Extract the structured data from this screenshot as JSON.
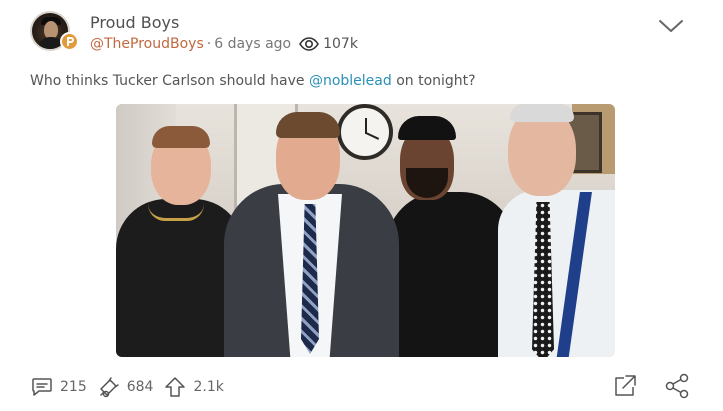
{
  "post": {
    "author": {
      "name": "Proud Boys",
      "handle": "@TheProudBoys",
      "time": "6 days ago",
      "views": "107k",
      "verified_badge": "parler-badge-icon"
    },
    "text": {
      "before": "Who thinks Tucker Carlson should have ",
      "mention": "@noblelead",
      "after": " on tonight?"
    },
    "image_alt": "Photo of four men standing together in an office",
    "actions": {
      "comments": "215",
      "echoes": "684",
      "upvotes": "2.1k"
    }
  },
  "colors": {
    "handle": "#c0683f",
    "mention": "#2b8fb8",
    "badge": "#e29a3a",
    "text": "#555555"
  },
  "icons": [
    "chevron-down-icon",
    "views-eye-icon",
    "comment-icon",
    "echo-megaphone-icon",
    "upvote-arrow-icon",
    "expand-icon",
    "share-icon"
  ]
}
